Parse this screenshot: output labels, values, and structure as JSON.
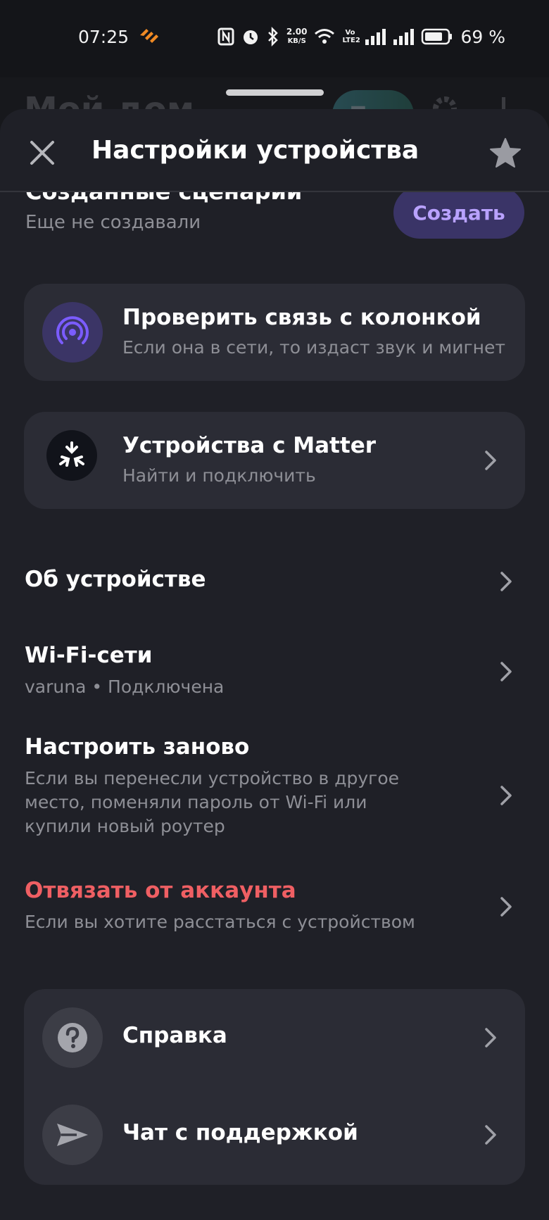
{
  "status_bar": {
    "time": "07:25",
    "speed_top": "2.00",
    "speed_bottom": "KB/S",
    "volte": "Vo LTE2",
    "battery": "69 %",
    "icons": [
      "app-notification-icon",
      "nfc-icon",
      "alarm-icon",
      "bluetooth-icon",
      "wifi-icon",
      "signal-icon",
      "signal-icon",
      "battery-icon"
    ]
  },
  "background": {
    "title": "Мой дом",
    "pill": "Про"
  },
  "sheet": {
    "title": "Настройки устройства",
    "scenarios": {
      "title": "Созданные сценарии",
      "subtitle": "Еще не создавали",
      "create_label": "Создать"
    },
    "check_card": {
      "title": "Проверить связь с колонкой",
      "subtitle": "Если она в сети, то издаст звук и мигнет",
      "icon": "broadcast-icon",
      "accent": "#7b5cff"
    },
    "matter_card": {
      "title": "Устройства с Matter",
      "subtitle": "Найти и подключить",
      "icon": "matter-icon"
    },
    "rows": [
      {
        "title": "Об устройстве",
        "subtitle": ""
      },
      {
        "title": "Wi-Fi-сети",
        "subtitle": "varuna • Подключена"
      },
      {
        "title": "Настроить заново",
        "subtitle": "Если вы перенесли устройство в другое место, поменяли пароль от Wi-Fi или купили новый роутер"
      },
      {
        "title": "Отвязать от аккаунта",
        "subtitle": "Если вы хотите расстаться с устройством",
        "color": "#ef5f63"
      }
    ],
    "support_card": {
      "items": [
        {
          "title": "Справка",
          "icon": "help-icon"
        },
        {
          "title": "Чат с поддержкой",
          "icon": "send-icon"
        }
      ]
    }
  }
}
